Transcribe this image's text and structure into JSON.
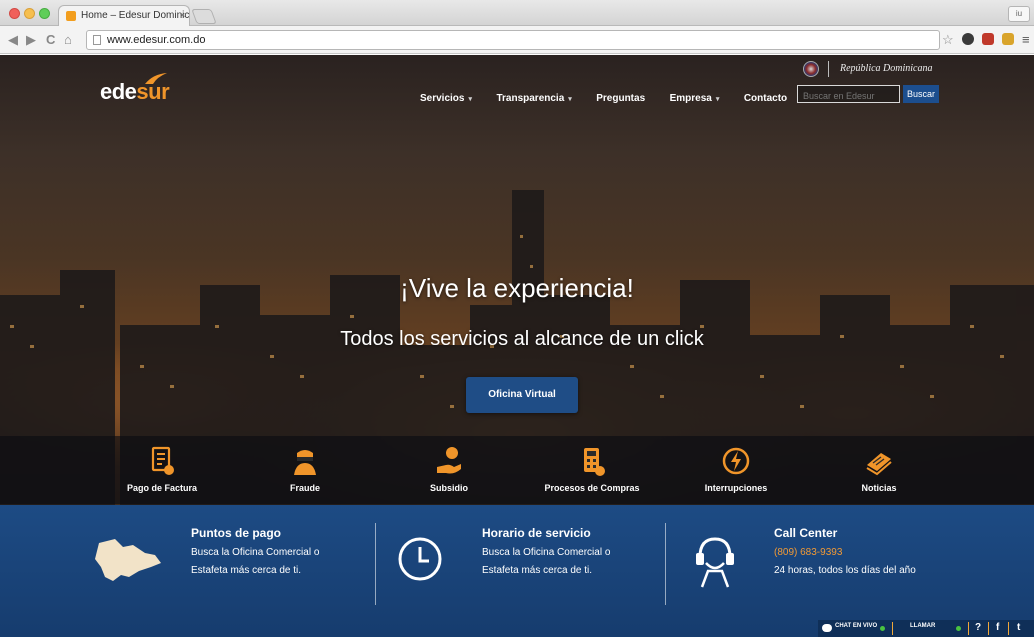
{
  "browser": {
    "tab_title": "Home – Edesur Dominicana",
    "url": "www.edesur.com.do",
    "tab_close": "×",
    "profile_label": "iu",
    "nav_glyphs": {
      "back": "◀",
      "forward": "▶",
      "reload": "C",
      "home": "⌂"
    },
    "star_glyph": "☆",
    "menu_glyph": "≡"
  },
  "header": {
    "logo_main": "ede",
    "logo_accent": "sur",
    "nav": [
      {
        "label": "Servicios",
        "dropdown": true
      },
      {
        "label": "Transparencia",
        "dropdown": true
      },
      {
        "label": "Preguntas",
        "dropdown": false
      },
      {
        "label": "Empresa",
        "dropdown": true
      },
      {
        "label": "Contacto",
        "dropdown": false
      }
    ],
    "caret": "▾",
    "search_placeholder": "Buscar en Edesur",
    "search_button": "Buscar",
    "gov_text": "República Dominicana"
  },
  "hero": {
    "headline": "¡Vive la experiencia!",
    "subheadline": "Todos los servicios al alcance de un click",
    "cta_label": "Oficina Virtual"
  },
  "services": [
    {
      "label": "Pago de Factura",
      "icon": "invoice-icon"
    },
    {
      "label": "Fraude",
      "icon": "thief-icon"
    },
    {
      "label": "Subsidio",
      "icon": "subsidy-hand-icon"
    },
    {
      "label": "Procesos de Compras",
      "icon": "purchase-calculator-icon"
    },
    {
      "label": "Interrupciones",
      "icon": "outage-icon"
    },
    {
      "label": "Noticias",
      "icon": "news-icon"
    }
  ],
  "info": {
    "puntos": {
      "title": "Puntos de pago",
      "line1": "Busca la Oficina Comercial o",
      "line2": "Estafeta más cerca de ti.",
      "icon": "map-icon"
    },
    "horario": {
      "title": "Horario de servicio",
      "line1": "Busca la Oficina Comercial o",
      "line2": "Estafeta más cerca de ti.",
      "icon": "clock-icon"
    },
    "call": {
      "title": "Call Center",
      "phone": "(809) 683-9393",
      "hours": "24 horas, todos los días del año",
      "icon": "headset-icon"
    }
  },
  "chatbar": {
    "chat_label": "CHAT EN VIVO",
    "call_label": "LLAMAR",
    "help_glyph": "?",
    "facebook_glyph": "f",
    "twitter_glyph": "t"
  },
  "colors": {
    "brand_orange": "#f0952a",
    "brand_blue": "#1d4b84",
    "online_green": "#49c340"
  }
}
